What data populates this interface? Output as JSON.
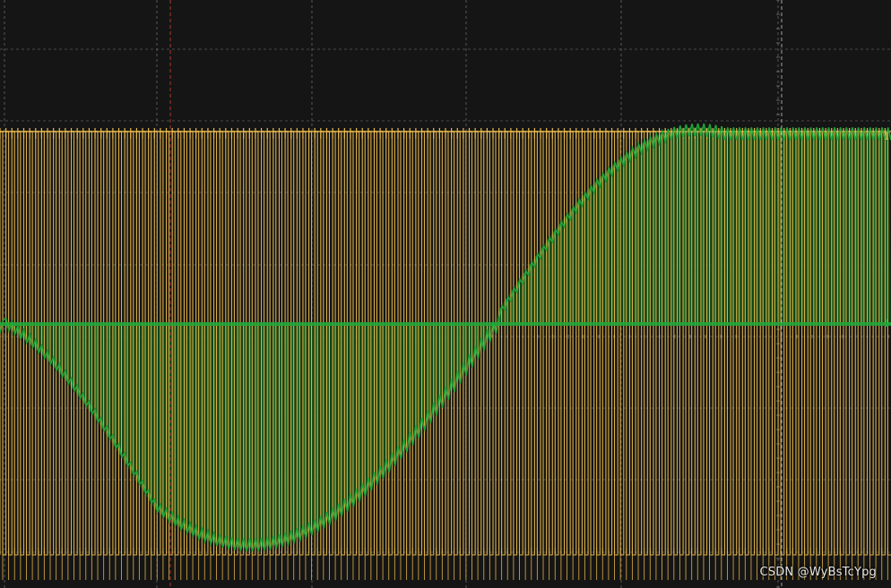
{
  "screen": {
    "background": "#151515",
    "grid_color": "#7a7a7a",
    "grid_divisions": {
      "horizontal": 10,
      "vertical": 8
    }
  },
  "cursors": [
    {
      "name": "cursor-a",
      "color": "#c0392b",
      "style": "dashed"
    },
    {
      "name": "cursor-b",
      "color": "#b0b0b0",
      "style": "dashed"
    }
  ],
  "channels": [
    {
      "id": "ch1",
      "color": "#e8b84a",
      "waveform": "pwm-square",
      "marker_label": "1",
      "pulse_count": 150
    },
    {
      "id": "ch2",
      "color": "#22a83a",
      "waveform": "modulated-sine",
      "marker_label": "1"
    }
  ],
  "watermark": "CSDN @WyBsTcYpg"
}
